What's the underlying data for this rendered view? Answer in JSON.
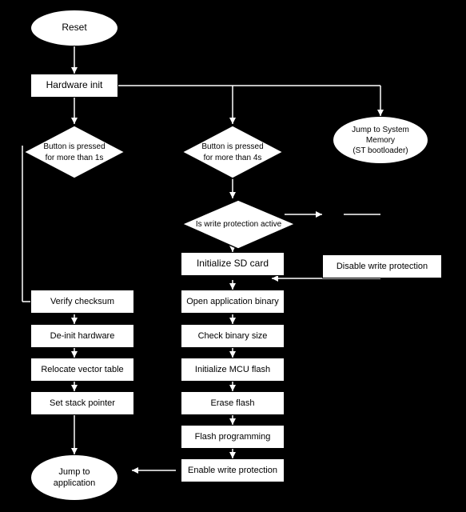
{
  "nodes": {
    "reset": {
      "label": "Reset"
    },
    "hardware_init": {
      "label": "Hardware init"
    },
    "button_1s": {
      "label": "Button is pressed\nfor more than 1s"
    },
    "button_4s": {
      "label": "Button is pressed\nfor more than 4s"
    },
    "jump_system": {
      "label": "Jump to System\nMemory\n(ST bootloader)"
    },
    "write_protection_active": {
      "label": "Is write protection active"
    },
    "init_sd": {
      "label": "Initialize SD card"
    },
    "disable_write": {
      "label": "Disable write protection"
    },
    "open_binary": {
      "label": "Open application binary"
    },
    "check_binary": {
      "label": "Check binary size"
    },
    "init_mcu": {
      "label": "Initialize MCU flash"
    },
    "erase_flash": {
      "label": "Erase flash"
    },
    "flash_programming": {
      "label": "Flash programming"
    },
    "enable_write": {
      "label": "Enable write protection"
    },
    "verify_checksum": {
      "label": "Verify checksum"
    },
    "deinit_hw": {
      "label": "De-init hardware"
    },
    "relocate_vector": {
      "label": "Relocate vector table"
    },
    "set_stack": {
      "label": "Set stack pointer"
    },
    "jump_application": {
      "label": "Jump to\napplication"
    }
  }
}
